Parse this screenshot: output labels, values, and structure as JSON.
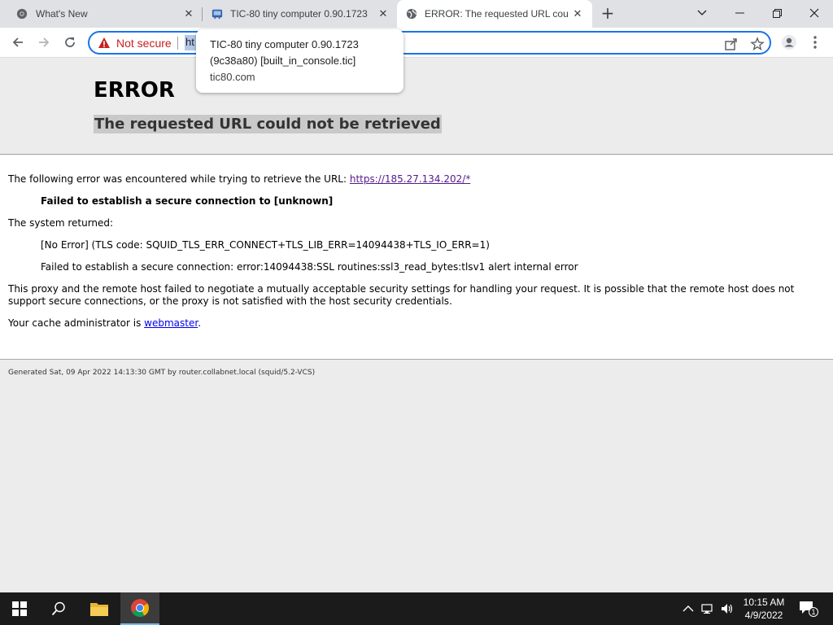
{
  "tabs": [
    {
      "title": "What's New",
      "icon": "chrome-icon",
      "active": false
    },
    {
      "title": "TIC-80 tiny computer 0.90.1723 (",
      "icon": "tic80-icon",
      "active": false
    },
    {
      "title": "ERROR: The requested URL could",
      "icon": "globe-icon",
      "active": true
    }
  ],
  "toolbar": {
    "not_secure_label": "Not secure",
    "url_visible": "ht"
  },
  "tooltip": {
    "title_line1": "TIC-80 tiny computer 0.90.1723",
    "title_line2": "(9c38a80) [built_in_console.tic]",
    "host": "tic80.com"
  },
  "page": {
    "heading": "ERROR",
    "subheading": "The requested URL could not be retrieved",
    "intro": "The following error was encountered while trying to retrieve the URL: ",
    "url_link": "https://185.27.134.202/*",
    "failed_msg": "Failed to establish a secure connection to [unknown]",
    "system_returned": "The system returned:",
    "tls_code": "[No Error] (TLS code: SQUID_TLS_ERR_CONNECT+TLS_LIB_ERR=14094438+TLS_IO_ERR=1)",
    "ssl_error": "Failed to establish a secure connection: error:14094438:SSL routines:ssl3_read_bytes:tlsv1 alert internal error",
    "explain_line1": "This proxy and the remote host failed to negotiate a mutually acceptable security settings for handling your request. It is possible that the remote host does not",
    "explain_line2": "support secure connections, or the proxy is not satisfied with the host security credentials.",
    "admin_prefix": "Your cache administrator is ",
    "admin_link": "webmaster",
    "admin_suffix": ".",
    "footer": "Generated Sat, 09 Apr 2022 14:13:30 GMT by router.collabnet.local (squid/5.2-VCS)"
  },
  "taskbar": {
    "time": "10:15 AM",
    "date": "4/9/2022",
    "notification_count": "1"
  },
  "colors": {
    "accent": "#1a73e8",
    "not_secure": "#c5221f",
    "link_visited": "#551a8b",
    "link": "#0000ee"
  }
}
